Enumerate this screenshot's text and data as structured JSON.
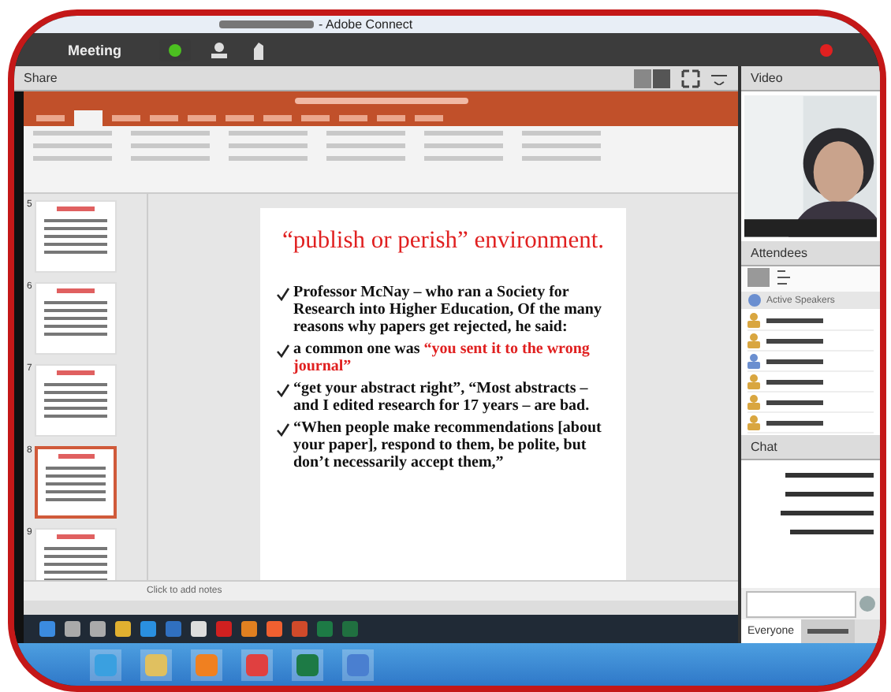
{
  "window": {
    "title": "- Adobe Connect"
  },
  "menu_bar": {
    "label": "Meeting"
  },
  "share_pod": {
    "title": "Share",
    "thumbnails": [
      {
        "number": "5",
        "selected": false
      },
      {
        "number": "6",
        "selected": false
      },
      {
        "number": "7",
        "selected": false
      },
      {
        "number": "8",
        "selected": true
      },
      {
        "number": "9",
        "selected": false
      }
    ],
    "slide": {
      "title": "“publish or perish” environment.",
      "bullets": [
        [
          {
            "text": "Professor McNay – who ran a Society for Research into Higher Education, Of the many reasons why papers get rejected, he said:",
            "emphasis": false
          }
        ],
        [
          {
            "text": "a common one was ",
            "emphasis": false
          },
          {
            "text": "“you sent it to the wrong journal”",
            "emphasis": true
          }
        ],
        [
          {
            "text": "“get your abstract right”, “Most abstracts – and I edited research for 17 years – are bad.",
            "emphasis": false
          }
        ],
        [
          {
            "text": "“When people make recommendations [about your paper], respond to them, be polite, but don’t necessarily accept them,”",
            "emphasis": false
          }
        ]
      ]
    },
    "notes_placeholder": "Click to add notes"
  },
  "video_pod": {
    "title": "Video"
  },
  "attendees_pod": {
    "title": "Attendees",
    "group": "Active Speakers",
    "attendees": [
      {
        "color": "#d9a640"
      },
      {
        "color": "#d9a640"
      },
      {
        "color": "#6b8fd0"
      },
      {
        "color": "#d9a640"
      },
      {
        "color": "#d9a640"
      },
      {
        "color": "#d9a640"
      }
    ]
  },
  "chat_pod": {
    "title": "Chat",
    "tabs": [
      {
        "label": "Everyone",
        "selected": true
      },
      {
        "selected": false
      }
    ]
  }
}
